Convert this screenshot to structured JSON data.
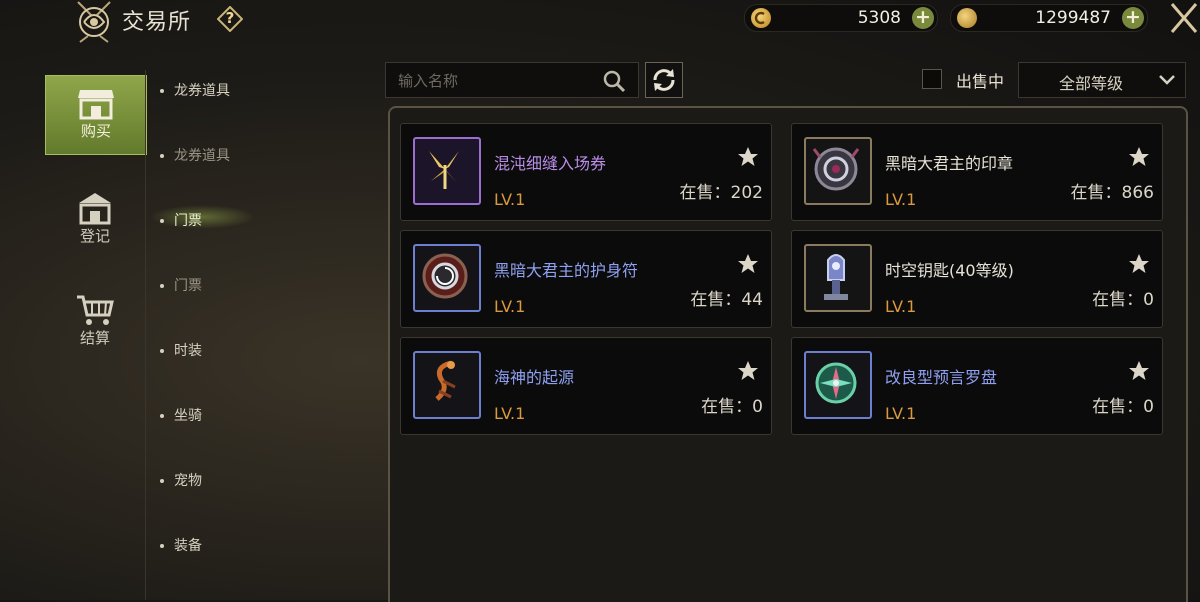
{
  "header": {
    "title": "交易所",
    "help_symbol": "?",
    "currency_a": {
      "value": "5308",
      "plus": "+"
    },
    "currency_b": {
      "value": "1299487",
      "plus": "+"
    }
  },
  "leftnav": {
    "items": [
      {
        "label": "购买",
        "icon": "shop-icon",
        "active": true
      },
      {
        "label": "登记",
        "icon": "bank-icon",
        "active": false
      },
      {
        "label": "结算",
        "icon": "cart-icon",
        "active": false
      }
    ]
  },
  "categories": [
    {
      "label": "龙券道具",
      "sub": false
    },
    {
      "label": "龙券道具",
      "sub": true
    },
    {
      "label": "门票",
      "sub": false,
      "active": true
    },
    {
      "label": "门票",
      "sub": true
    },
    {
      "label": "时装",
      "sub": false
    },
    {
      "label": "坐骑",
      "sub": false
    },
    {
      "label": "宠物",
      "sub": false
    },
    {
      "label": "装备",
      "sub": false
    }
  ],
  "toolbar": {
    "search_placeholder": "输入名称",
    "on_sale_label": "出售中",
    "level_filter": "全部等级"
  },
  "items": [
    {
      "name": "混沌细缝入场券",
      "level": "LV.1",
      "stock": "在售：202",
      "name_color": "#b98ce6",
      "frame": "#9a6fd0",
      "icon": "butterfly-ticket-icon"
    },
    {
      "name": "黑暗大君主的印章",
      "level": "LV.1",
      "stock": "在售：866",
      "name_color": "#e6e2d6",
      "frame": "#8a7a5e",
      "icon": "dark-seal-icon"
    },
    {
      "name": "黑暗大君主的护身符",
      "level": "LV.1",
      "stock": "在售：44",
      "name_color": "#8fa0f0",
      "frame": "#6f7fd0",
      "icon": "dark-amulet-icon"
    },
    {
      "name": "时空钥匙(40等级)",
      "level": "LV.1",
      "stock": "在售：0",
      "name_color": "#e6e2d6",
      "frame": "#8a7a5e",
      "icon": "space-key-icon"
    },
    {
      "name": "海神的起源",
      "level": "LV.1",
      "stock": "在售：0",
      "name_color": "#8fa0f0",
      "frame": "#6f7fd0",
      "icon": "sea-god-icon"
    },
    {
      "name": "改良型预言罗盘",
      "level": "LV.1",
      "stock": "在售：0",
      "name_color": "#8fa0f0",
      "frame": "#6f7fd0",
      "icon": "prophecy-compass-icon"
    }
  ],
  "colors": {
    "accent_green": "#7a8a3c",
    "level_orange": "#d9993c"
  }
}
